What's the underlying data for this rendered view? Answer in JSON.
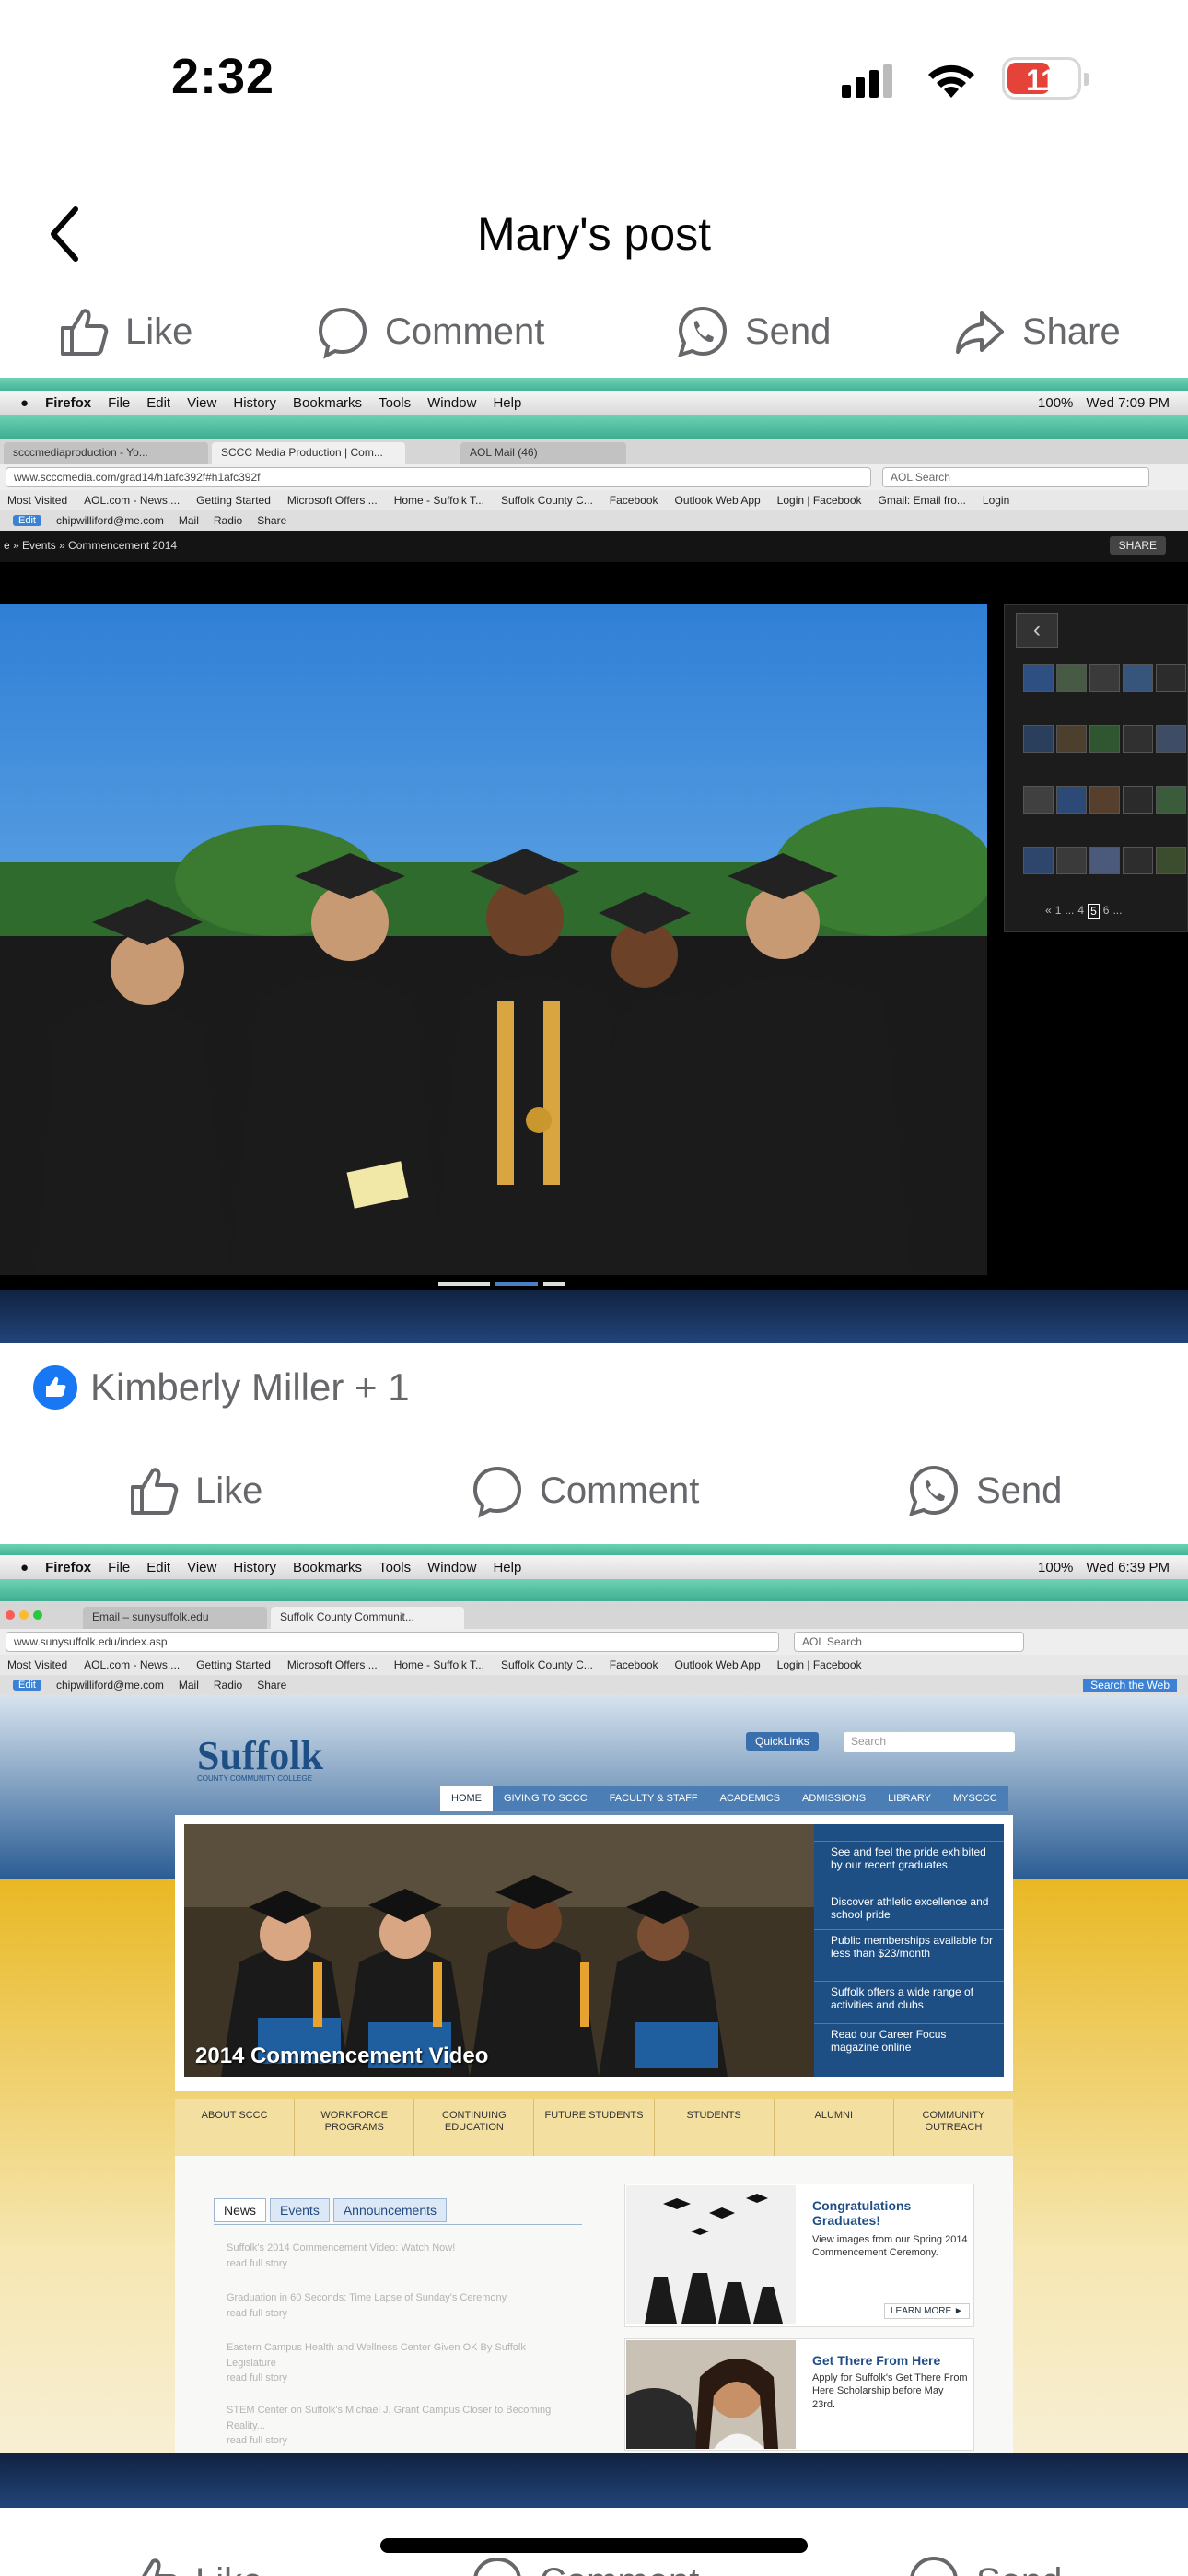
{
  "status_bar": {
    "time": "2:32",
    "battery": "11"
  },
  "header": {
    "title": "Mary's post"
  },
  "actions_top": {
    "like": "Like",
    "comment": "Comment",
    "send": "Send",
    "share": "Share"
  },
  "actions_mid": {
    "like": "Like",
    "comment": "Comment",
    "send": "Send"
  },
  "actions_bottom": {
    "like": "Like",
    "comment": "Comment",
    "send": "Send"
  },
  "reactions": {
    "text": "Kimberly Miller + 1"
  },
  "photo1": {
    "menu": [
      "Firefox",
      "File",
      "Edit",
      "View",
      "History",
      "Bookmarks",
      "Tools",
      "Window",
      "Help"
    ],
    "clock": "Wed 7:09 PM",
    "battery": "100%",
    "tabs": [
      "scccmediaproduction - Yo...",
      "SCCC Media Production | Com...",
      "AOL Mail (46)"
    ],
    "url": "www.scccmedia.com/grad14/h1afc392f#h1afc392f",
    "search": "AOL Search",
    "bookmarks": [
      "Most Visited",
      "AOL.com - News,...",
      "Getting Started",
      "Microsoft Offers ...",
      "Home - Suffolk T...",
      "Suffolk County C...",
      "Facebook",
      "Outlook Web App",
      "Login | Facebook",
      "Gmail: Email fro...",
      "Login"
    ],
    "aol_edit": "Edit",
    "aol_email": "chipwilliford@me.com",
    "aol_mail": "Mail",
    "aol_radio": "Radio",
    "aol_share": "Share",
    "breadcrumb": "e » Events » Commencement 2014",
    "share_btn": "SHARE",
    "pager": [
      "«",
      "1",
      "...",
      "4",
      "5",
      "6",
      "..."
    ]
  },
  "photo2": {
    "menu": [
      "Firefox",
      "File",
      "Edit",
      "View",
      "History",
      "Bookmarks",
      "Tools",
      "Window",
      "Help"
    ],
    "clock": "Wed 6:39 PM",
    "battery": "100%",
    "tabs": [
      "Email – sunysuffolk.edu",
      "Suffolk County Communit..."
    ],
    "url": "www.sunysuffolk.edu/index.asp",
    "search": "AOL Search",
    "bookmarks": [
      "Most Visited",
      "AOL.com - News,...",
      "Getting Started",
      "Microsoft Offers ...",
      "Home - Suffolk T...",
      "Suffolk County C...",
      "Facebook",
      "Outlook Web App",
      "Login | Facebook"
    ],
    "aol_edit": "Edit",
    "aol_email": "chipwilliford@me.com",
    "aol_mail": "Mail",
    "aol_radio": "Radio",
    "aol_share": "Share",
    "search_web": "Search the Web",
    "site": {
      "logo": "Suffolk",
      "logo_sub": "COUNTY COMMUNITY COLLEGE",
      "quicklinks": "QuickLinks",
      "search_placeholder": "Search",
      "nav": [
        "HOME",
        "GIVING TO SCCC",
        "FACULTY & STAFF",
        "ACADEMICS",
        "ADMISSIONS",
        "LIBRARY",
        "MYSCCC"
      ],
      "hero_caption": "2014 Commencement Video",
      "side": [
        "See and feel the pride exhibited by our recent graduates",
        "Discover athletic excellence and school pride",
        "Public memberships available for less than $23/month",
        "Suffolk offers a wide range of activities and clubs",
        "Read our Career Focus magazine online"
      ],
      "categories": [
        "ABOUT SCCC",
        "WORKFORCE PROGRAMS",
        "CONTINUING EDUCATION",
        "FUTURE STUDENTS",
        "STUDENTS",
        "ALUMNI",
        "COMMUNITY OUTREACH"
      ],
      "news_tabs": [
        "News",
        "Events",
        "Announcements"
      ],
      "news": [
        "Suffolk's 2014 Commencement Video: Watch Now!",
        "Graduation in 60 Seconds: Time Lapse of Sunday's Ceremony",
        "Eastern Campus Health and Wellness Center Given OK By Suffolk Legislature",
        "STEM Center on Suffolk's Michael J. Grant Campus Closer to Becoming Reality..."
      ],
      "read_more": "read full story",
      "promo1_title": "Congratulations Graduates!",
      "promo1_body": "View images from our Spring 2014 Commencement Ceremony.",
      "learn_more": "LEARN MORE ►",
      "promo2_title": "Get There From Here",
      "promo2_body": "Apply for Suffolk's Get There From Here Scholarship before May 23rd."
    }
  },
  "colors": {
    "facebook_blue": "#1877f2",
    "gray_text": "#65676b",
    "suffolk_blue": "#1e4f84",
    "suffolk_gold": "#f2c230"
  }
}
